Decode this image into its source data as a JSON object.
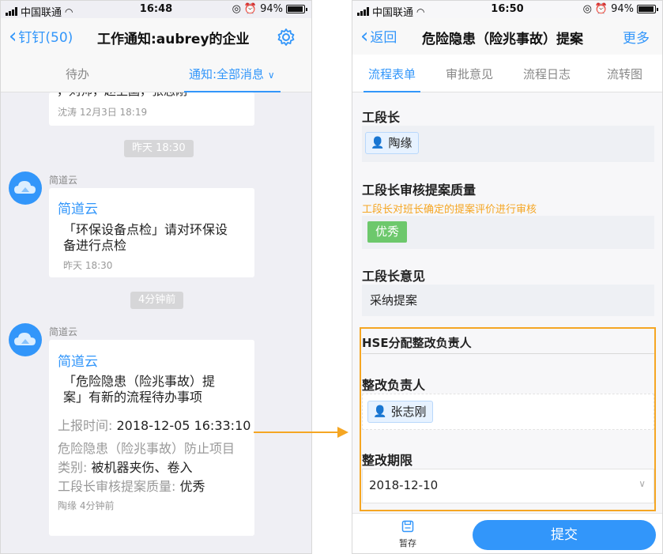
{
  "left": {
    "status": {
      "carrier": "中国联通",
      "time": "16:48",
      "battery": "94%"
    },
    "nav": {
      "back_label": "钉钉(50)",
      "title": "工作通知:aubrey的企业"
    },
    "tabs": [
      {
        "label": "待办"
      },
      {
        "label": "通知:全部消息"
      }
    ],
    "top_card": {
      "text": "，刘帅，赵卫国，张志刚",
      "meta": "沈涛   12月3日 18:19"
    },
    "time_chip_1": "昨天 18:30",
    "msg1": {
      "sender": "简道云",
      "source": "简道云",
      "body": [
        "「环保设备点检」请对环保设",
        "备进行点检"
      ],
      "meta": "昨天 18:30"
    },
    "time_chip_2": "4分钟前",
    "msg2": {
      "sender": "简道云",
      "source": "简道云",
      "body": [
        "「危险隐患（险兆事故）提",
        "案」有新的流程待办事项"
      ],
      "report_time_label": "上报时间:",
      "report_time_value": "2018-12-05 16:33:10",
      "project_label": "危险隐患（险兆事故）防止项目",
      "category_label": "类别:",
      "category_value": "被机器夹伤、卷入",
      "quality_label": "工段长审核提案质量:",
      "quality_value": "优秀",
      "meta": "陶缘   4分钟前"
    }
  },
  "right": {
    "status": {
      "carrier": "中国联通",
      "time": "16:50",
      "battery": "94%"
    },
    "nav": {
      "back_label": "返回",
      "title": "危险隐患（险兆事故）提案",
      "more_label": "更多"
    },
    "tabs": [
      {
        "label": "流程表单"
      },
      {
        "label": "审批意见"
      },
      {
        "label": "流程日志"
      },
      {
        "label": "流转图"
      }
    ],
    "form": {
      "foreman_label": "工段长",
      "foreman_value": "陶缘",
      "quality_label": "工段长审核提案质量",
      "quality_hint": "工段长对班长确定的提案评价进行审核",
      "quality_value": "优秀",
      "opinion_label": "工段长意见",
      "opinion_value": "采纳提案",
      "hse_section": "HSE分配整改负责人",
      "owner_label": "整改负责人",
      "owner_value": "张志刚",
      "deadline_label": "整改期限",
      "deadline_value": "2018-12-10"
    },
    "footer": {
      "save_label": "暂存",
      "submit_label": "提交"
    }
  },
  "colors": {
    "accent": "#3296fa",
    "highlight": "#f5a623",
    "success": "#6dc86c"
  }
}
